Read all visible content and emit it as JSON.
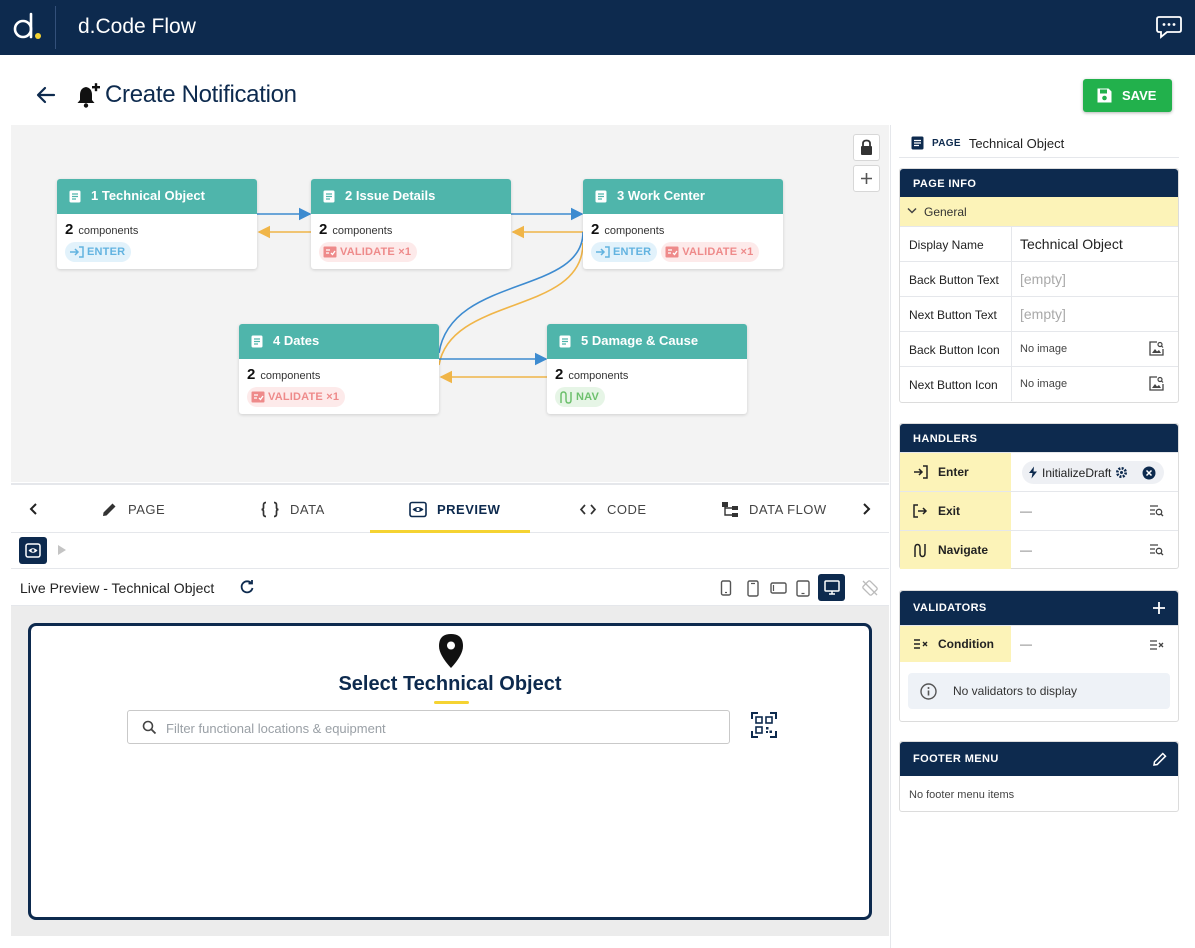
{
  "app": {
    "title": "d.Code Flow"
  },
  "header": {
    "page_title": "Create Notification",
    "save_label": "SAVE"
  },
  "flow": {
    "nodes": [
      {
        "title": "1 Technical Object",
        "count": "2",
        "count_label": "components",
        "badges": [
          {
            "type": "enter",
            "label": "ENTER"
          }
        ]
      },
      {
        "title": "2 Issue Details",
        "count": "2",
        "count_label": "components",
        "badges": [
          {
            "type": "validate",
            "label": "VALIDATE ×1"
          }
        ]
      },
      {
        "title": "3 Work Center",
        "count": "2",
        "count_label": "components",
        "badges": [
          {
            "type": "enter",
            "label": "ENTER"
          },
          {
            "type": "validate",
            "label": "VALIDATE ×1"
          }
        ]
      },
      {
        "title": "4 Dates",
        "count": "2",
        "count_label": "components",
        "badges": [
          {
            "type": "validate",
            "label": "VALIDATE ×1"
          }
        ]
      },
      {
        "title": "5 Damage & Cause",
        "count": "2",
        "count_label": "components",
        "badges": [
          {
            "type": "nav",
            "label": "NAV"
          }
        ]
      }
    ],
    "edge_colors": {
      "forward": "#3d8bd0",
      "back": "#f0b548"
    }
  },
  "tabs": [
    {
      "label": "PAGE",
      "icon": "pencil-icon"
    },
    {
      "label": "DATA",
      "icon": "braces-icon"
    },
    {
      "label": "PREVIEW",
      "icon": "eye-icon",
      "active": true
    },
    {
      "label": "CODE",
      "icon": "code-icon"
    },
    {
      "label": "DATA FLOW",
      "icon": "hierarchy-icon"
    }
  ],
  "preview": {
    "title": "Live Preview - Technical Object",
    "screen_title": "Select Technical Object",
    "search_placeholder": "Filter functional locations & equipment",
    "devices": [
      "phone-small",
      "phone",
      "phone-landscape",
      "tablet",
      "desktop"
    ],
    "active_device": "desktop"
  },
  "right_panel": {
    "header": {
      "kind": "PAGE",
      "name": "Technical Object"
    },
    "page_info": {
      "title": "PAGE INFO",
      "group": "General",
      "rows": [
        {
          "label": "Display Name",
          "value": "Technical Object",
          "style": "text"
        },
        {
          "label": "Back Button Text",
          "value": "[empty]",
          "style": "empty"
        },
        {
          "label": "Next Button Text",
          "value": "[empty]",
          "style": "empty"
        },
        {
          "label": "Back Button Icon",
          "value": "No image",
          "style": "image"
        },
        {
          "label": "Next Button Icon",
          "value": "No image",
          "style": "image"
        }
      ]
    },
    "handlers": {
      "title": "HANDLERS",
      "enter": {
        "label": "Enter",
        "value": "InitializeDraft"
      },
      "exit": {
        "label": "Exit",
        "value": "—"
      },
      "navigate": {
        "label": "Navigate",
        "value": "—"
      }
    },
    "validators": {
      "title": "VALIDATORS",
      "condition_label": "Condition",
      "condition_value": "—",
      "empty_text": "No validators to display"
    },
    "footer_menu": {
      "title": "FOOTER MENU",
      "empty_text": "No footer menu items"
    }
  },
  "colors": {
    "navy": "#0d2a4e",
    "teal": "#4fb5ab",
    "accent_yellow": "#f5d332",
    "save_green": "#22b14c"
  }
}
